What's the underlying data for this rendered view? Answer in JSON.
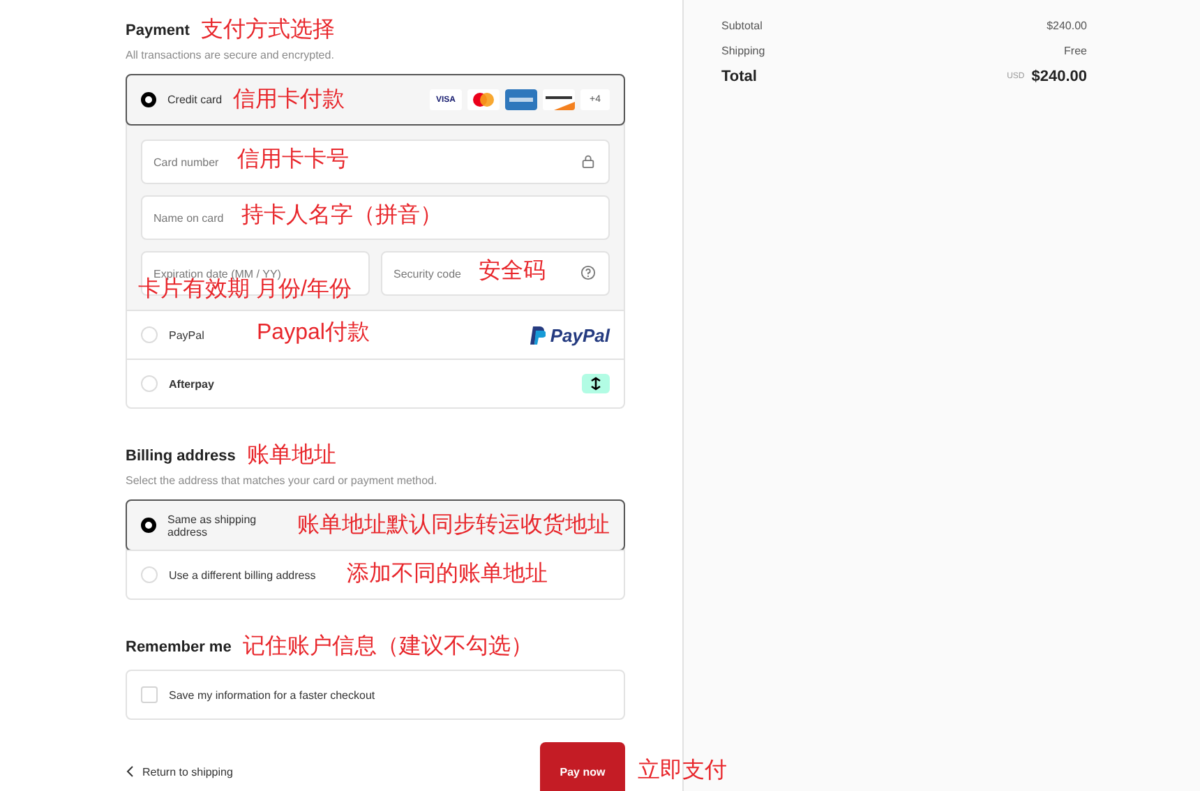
{
  "payment": {
    "title": "Payment",
    "note": "支付方式选择",
    "subtitle": "All transactions are secure and encrypted.",
    "methods": [
      {
        "kind": "card",
        "label": "Credit card",
        "note": "信用卡付款",
        "selected": true,
        "brands": [
          {
            "kind": "visa",
            "label": "VISA"
          },
          {
            "kind": "mastercard"
          },
          {
            "kind": "amex"
          },
          {
            "kind": "discover"
          }
        ],
        "more": "+4",
        "fields": [
          {
            "kind": "number",
            "placeholder": "Card number",
            "note": "信用卡卡号"
          },
          {
            "kind": "name",
            "placeholder": "Name on card",
            "note": "持卡人名字（拼音）"
          },
          {
            "kind": "expiry",
            "placeholder": "Expiration date (MM / YY)",
            "note": "卡片有效期 月份/年份"
          },
          {
            "kind": "security",
            "placeholder": "Security code",
            "note": "安全码"
          }
        ]
      },
      {
        "kind": "paypal",
        "label": "PayPal",
        "note": "Paypal付款",
        "selected": false,
        "logo": "PayPal"
      },
      {
        "kind": "afterpay",
        "label": "Afterpay",
        "selected": false
      }
    ]
  },
  "billing": {
    "title": "Billing address",
    "note": "账单地址",
    "subtitle": "Select the address that matches your card or payment method.",
    "options": [
      {
        "label": "Same as shipping address",
        "note": "账单地址默认同步转运收货地址",
        "selected": true
      },
      {
        "label": "Use a different billing address",
        "note": "添加不同的账单地址",
        "selected": false
      }
    ]
  },
  "remember": {
    "title": "Remember me",
    "note": "记住账户信息（建议不勾选）",
    "option": {
      "label": "Save my information for a faster checkout",
      "checked": false
    }
  },
  "footer": {
    "back_link": "Return to shipping",
    "pay_button": "Pay now",
    "note": "立即支付"
  },
  "summary": {
    "rows": [
      {
        "kind": "normal",
        "label": "Subtotal",
        "value": "$240.00"
      },
      {
        "kind": "normal",
        "label": "Shipping",
        "value": "Free"
      },
      {
        "kind": "total",
        "label": "Total",
        "currency": "USD",
        "value": "$240.00"
      }
    ]
  }
}
